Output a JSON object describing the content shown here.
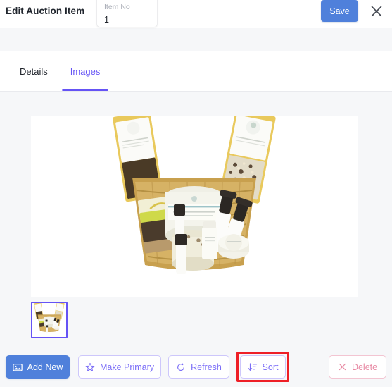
{
  "header": {
    "title": "Edit Auction Item",
    "item_no_label": "Item No",
    "item_no_value": "1",
    "save_label": "Save",
    "close_icon": "close-icon"
  },
  "tabs": [
    {
      "label": "Details",
      "active": false
    },
    {
      "label": "Images",
      "active": true
    }
  ],
  "images_tab": {
    "main_image_alt": "Gift basket with bath and body products",
    "thumbnails": [
      {
        "alt": "Gift basket thumbnail",
        "selected": true
      }
    ]
  },
  "actions": {
    "add_new": {
      "label": "Add New",
      "icon": "image-icon"
    },
    "make_primary": {
      "label": "Make Primary",
      "icon": "star-icon"
    },
    "refresh": {
      "label": "Refresh",
      "icon": "refresh-icon"
    },
    "sort": {
      "label": "Sort",
      "icon": "sort-descending-icon",
      "highlighted": true
    },
    "delete": {
      "label": "Delete",
      "icon": "close-icon"
    }
  },
  "colors": {
    "accent_purple": "#6553f5",
    "outline_purple": "#7a6df7",
    "primary_blue": "#4f80db",
    "danger_pink": "#e88aa4",
    "annotation_red": "#ee1f26",
    "page_background": "#f6f7f9",
    "panel_white": "#ffffff"
  }
}
